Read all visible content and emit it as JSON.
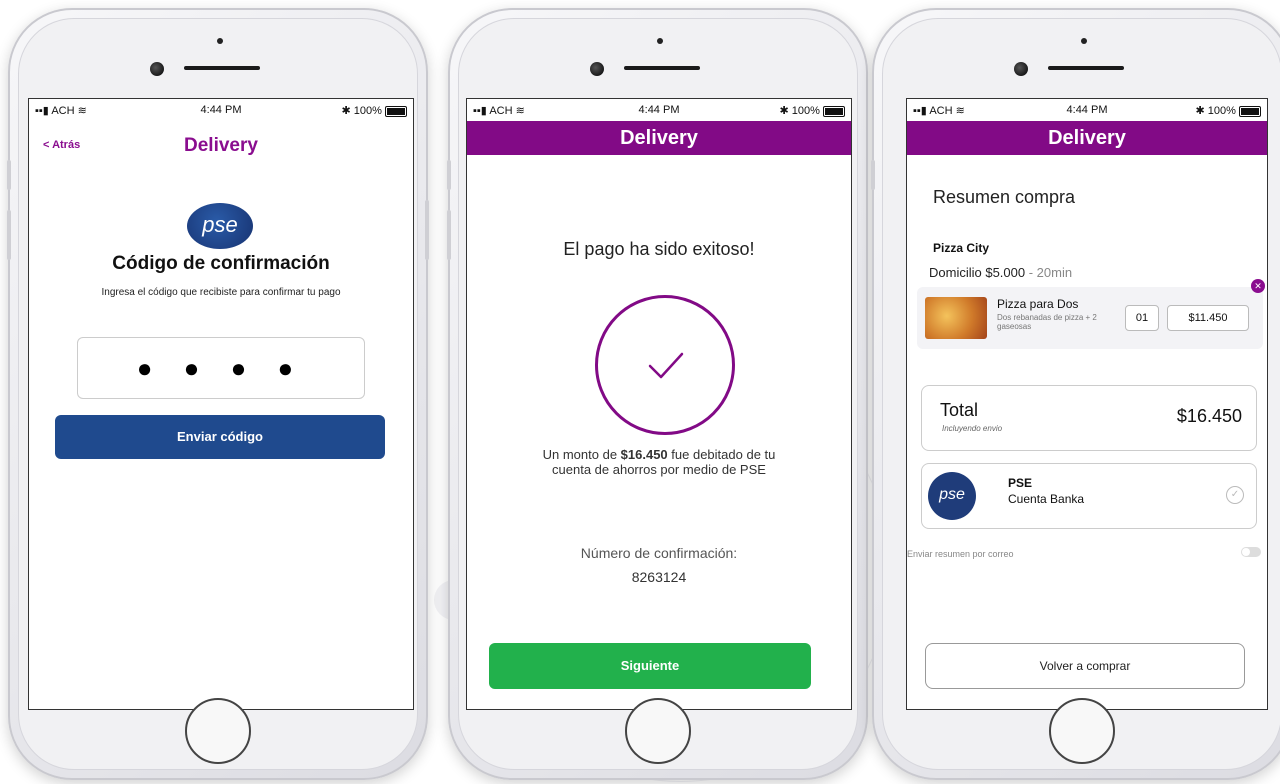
{
  "colors": {
    "brand_purple": "#820a86",
    "pse_blue": "#1f4a8e",
    "success_green": "#22b14c"
  },
  "status_bar": {
    "carrier": "ACH",
    "time": "4:44 PM",
    "battery": "100%"
  },
  "screen1": {
    "back_label": "< Atrás",
    "title": "Delivery",
    "logo_text": "pse",
    "heading": "Código de confirmación",
    "instruction": "Ingresa el código que recibiste para confirmar tu pago",
    "code_mask": "● ● ● ●",
    "send_button": "Enviar código"
  },
  "screen2": {
    "title": "Delivery",
    "success_text": "El pago ha sido exitoso!",
    "check_icon": "checkmark-icon",
    "debit_prefix": "Un monto de ",
    "debit_amount": "$16.450",
    "debit_suffix": " fue debitado de tu cuenta de ahorros por medio de PSE",
    "confirmation_label": "Número de confirmación:",
    "confirmation_number": "8263124",
    "next_button": "Siguiente"
  },
  "screen3": {
    "title": "Delivery",
    "summary_title": "Resumen compra",
    "restaurant": "Pizza City",
    "delivery_label": "Domicilio $5.000",
    "delivery_time": " - 20min",
    "item": {
      "name": "Pizza para Dos",
      "description": "Dos rebanadas de pizza + 2 gaseosas",
      "quantity": "01",
      "price": "$11.450"
    },
    "total_label": "Total",
    "total_note": "Incluyendo envio",
    "total_value": "$16.450",
    "payment": {
      "logo_text": "pse",
      "name": "PSE",
      "account": "Cuenta Banka"
    },
    "email_toggle_label": "Enviar resumen por correo",
    "email_toggle_on": false,
    "buy_again_button": "Volver a comprar"
  }
}
